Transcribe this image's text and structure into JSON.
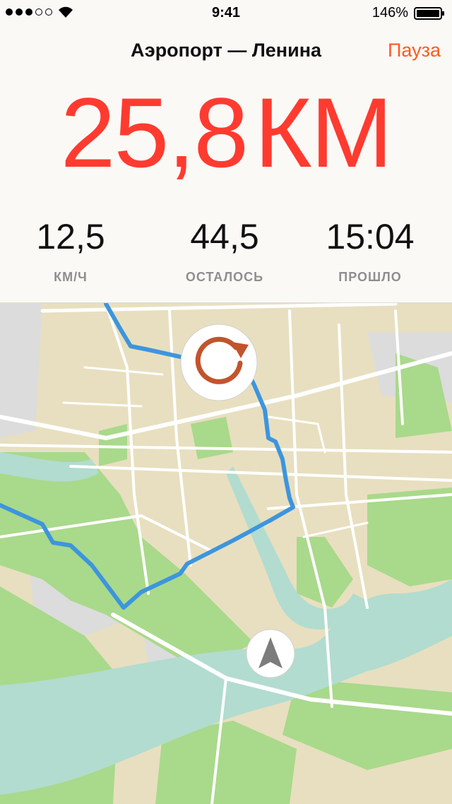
{
  "status_bar": {
    "time": "9:41",
    "battery": "146%",
    "signal_bars": 3,
    "signal_total": 5
  },
  "header": {
    "title": "Аэропорт — Ленина",
    "pause_label": "Пауза",
    "distance_value": "25,8",
    "distance_unit": "КМ"
  },
  "stats": [
    {
      "value": "12,5",
      "label": "КМ/Ч"
    },
    {
      "value": "44,5",
      "label": "ОСТАЛОСЬ"
    },
    {
      "value": "15:04",
      "label": "ПРОШЛО"
    }
  ],
  "map": {
    "recenter_button_icon": "refresh-icon",
    "location_button_icon": "navigation-arrow-icon"
  },
  "colors": {
    "accent": "#ff3b30",
    "pause": "#ff5a1f",
    "route": "#3d95dd",
    "refresh_icon": "#c2542c",
    "land": "#e8dfc0",
    "park": "#a9d98b",
    "water": "#b2dccf"
  }
}
